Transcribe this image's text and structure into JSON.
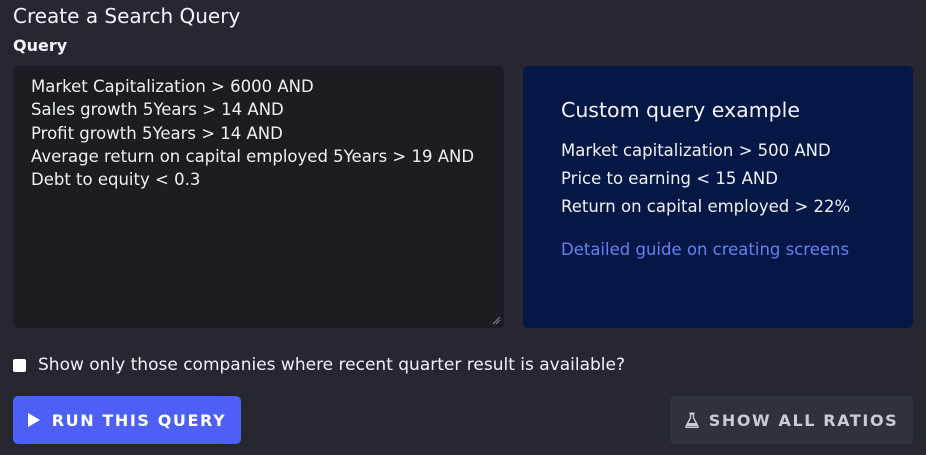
{
  "page": {
    "title": "Create a Search Query",
    "query_label": "Query"
  },
  "query": {
    "lines": [
      "Market Capitalization > 6000 AND",
      "Sales growth 5Years > 14 AND",
      "Profit growth 5Years > 14 AND",
      "Average return on capital employed 5Years > 19 AND",
      "Debt to equity < 0.3"
    ]
  },
  "example": {
    "title": "Custom query example",
    "lines": [
      "Market capitalization > 500 AND",
      "Price to earning < 15 AND",
      "Return on capital employed > 22%"
    ],
    "link": "Detailed guide on creating screens"
  },
  "options": {
    "checkbox_label": "Show only those companies where recent quarter result is available?",
    "checked": false
  },
  "buttons": {
    "run": "RUN THIS QUERY",
    "ratios": "SHOW ALL RATIOS"
  },
  "icons": {
    "run": "play-icon",
    "ratios": "flask-icon"
  },
  "colors": {
    "background": "#262731",
    "query_bg": "#1c1d22",
    "example_bg": "#041745",
    "link": "#6a7ff7",
    "primary_button": "#4d5ff5",
    "secondary_button": "#30323b"
  }
}
